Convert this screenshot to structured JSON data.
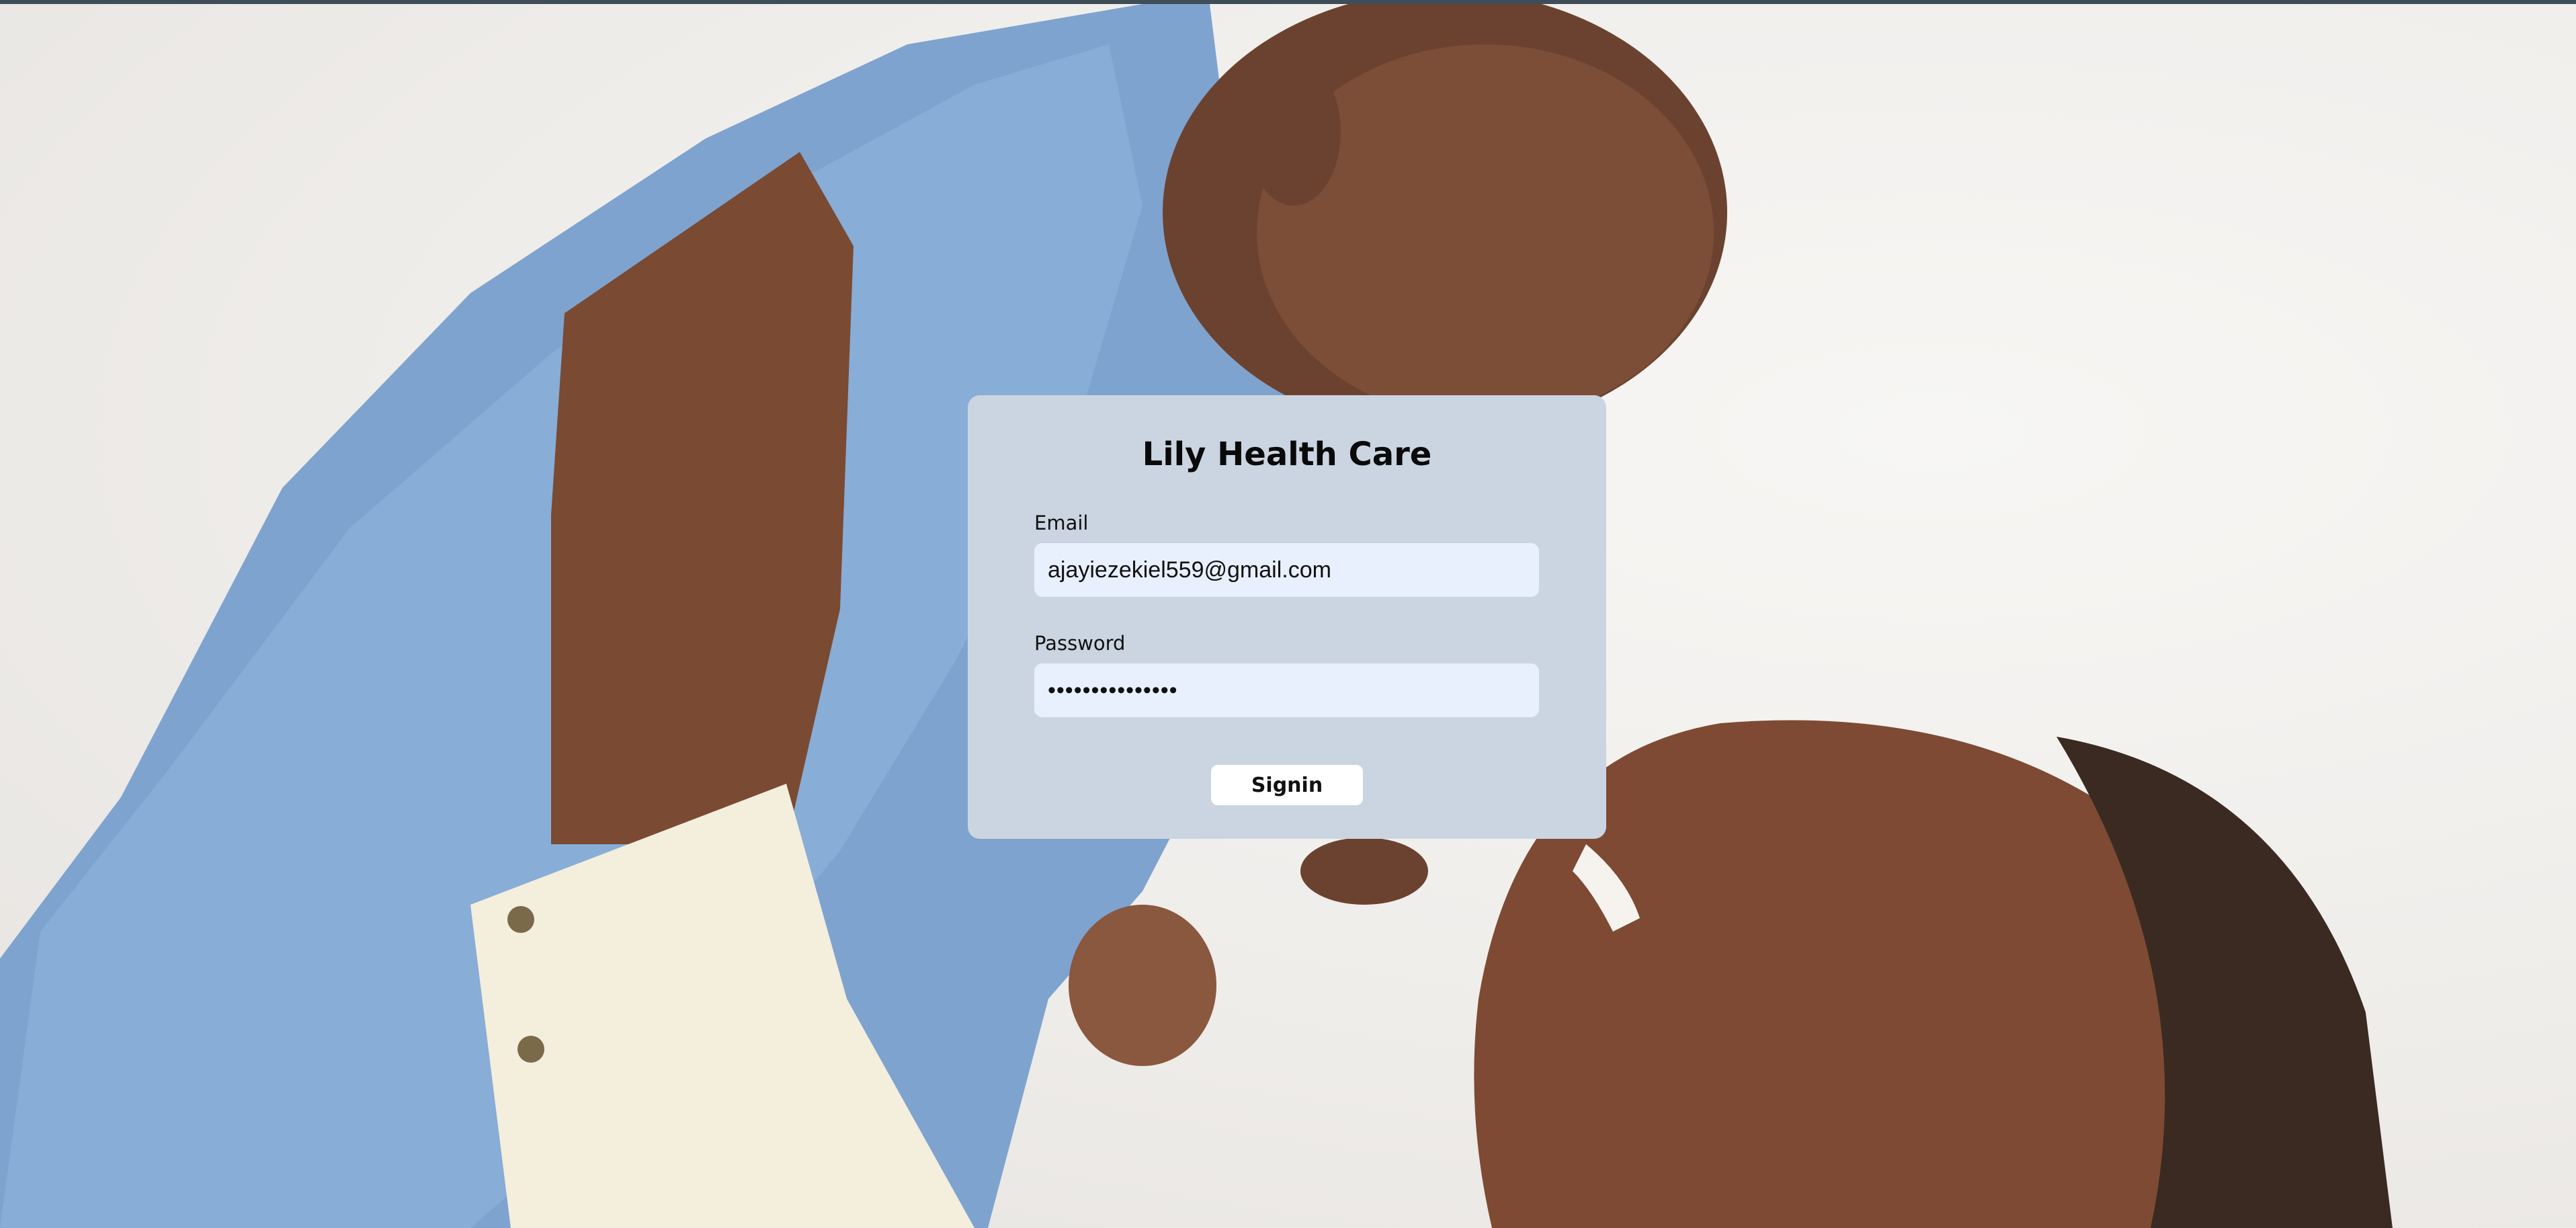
{
  "app": {
    "title": "Lily Health Care"
  },
  "login_form": {
    "email_label": "Email",
    "email_value": "ajayiezekiel559@gmail.com",
    "password_label": "Password",
    "password_value": "•••••••••••••••",
    "signin_label": "Signin"
  },
  "background": {
    "description_icon": "mother-and-baby-photo"
  },
  "colors": {
    "card_background": "#cbd5e1",
    "input_background": "#e8f0fe",
    "button_background": "#ffffff",
    "top_bar": "#3e4d57"
  }
}
